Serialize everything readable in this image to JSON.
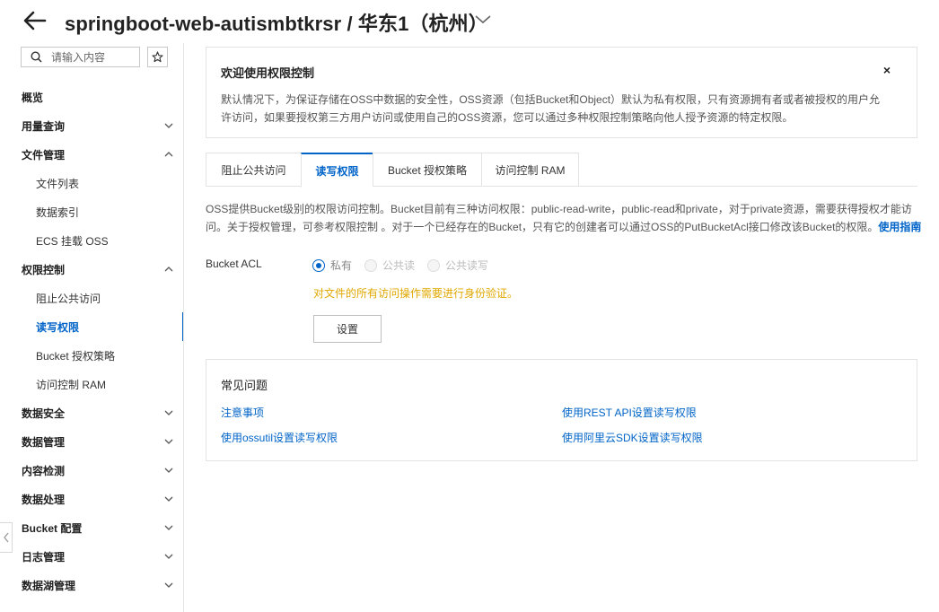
{
  "header": {
    "title": "springboot-web-autismbtkrsr / 华东1（杭州）"
  },
  "sidebar": {
    "search_placeholder": "请输入内容",
    "items": [
      {
        "label": "概览",
        "level": "top",
        "chevron": "none"
      },
      {
        "label": "用量查询",
        "level": "top",
        "chevron": "down"
      },
      {
        "label": "文件管理",
        "level": "top",
        "chevron": "up"
      },
      {
        "label": "文件列表",
        "level": "sub"
      },
      {
        "label": "数据索引",
        "level": "sub"
      },
      {
        "label": "ECS 挂载 OSS",
        "level": "sub"
      },
      {
        "label": "权限控制",
        "level": "top",
        "chevron": "up"
      },
      {
        "label": "阻止公共访问",
        "level": "sub"
      },
      {
        "label": "读写权限",
        "level": "sub",
        "active": true
      },
      {
        "label": "Bucket 授权策略",
        "level": "sub"
      },
      {
        "label": "访问控制 RAM",
        "level": "sub"
      },
      {
        "label": "数据安全",
        "level": "top",
        "chevron": "down"
      },
      {
        "label": "数据管理",
        "level": "top",
        "chevron": "down"
      },
      {
        "label": "内容检测",
        "level": "top",
        "chevron": "down"
      },
      {
        "label": "数据处理",
        "level": "top",
        "chevron": "down"
      },
      {
        "label": "Bucket 配置",
        "level": "top",
        "chevron": "down"
      },
      {
        "label": "日志管理",
        "level": "top",
        "chevron": "down"
      },
      {
        "label": "数据湖管理",
        "level": "top",
        "chevron": "down"
      }
    ]
  },
  "welcome": {
    "title": "欢迎使用权限控制",
    "body": "默认情况下，为保证存储在OSS中数据的安全性，OSS资源（包括Bucket和Object）默认为私有权限，只有资源拥有者或者被授权的用户允许访问，如果要授权第三方用户访问或使用自己的OSS资源，您可以通过多种权限控制策略向他人授予资源的特定权限。",
    "close": "×"
  },
  "tabs": [
    {
      "label": "阻止公共访问",
      "active": false
    },
    {
      "label": "读写权限",
      "active": true
    },
    {
      "label": "Bucket 授权策略",
      "active": false
    },
    {
      "label": "访问控制 RAM",
      "active": false
    }
  ],
  "description": {
    "text": "OSS提供Bucket级别的权限访问控制。Bucket目前有三种访问权限：public-read-write，public-read和private，对于private资源，需要获得授权才能访问。关于授权管理，可参考权限控制 。对于一个已经存在的Bucket，只有它的创建者可以通过OSS的PutBucketAcl接口修改该Bucket的权限。",
    "link": "使用指南"
  },
  "acl": {
    "label": "Bucket ACL",
    "options": [
      {
        "label": "私有",
        "checked": true
      },
      {
        "label": "公共读",
        "checked": false
      },
      {
        "label": "公共读写",
        "checked": false
      }
    ],
    "note": "对文件的所有访问操作需要进行身份验证。",
    "button": "设置"
  },
  "faq": {
    "title": "常见问题",
    "links": [
      "注意事项",
      "使用REST API设置读写权限",
      "使用ossutil设置读写权限",
      "使用阿里云SDK设置读写权限"
    ]
  }
}
